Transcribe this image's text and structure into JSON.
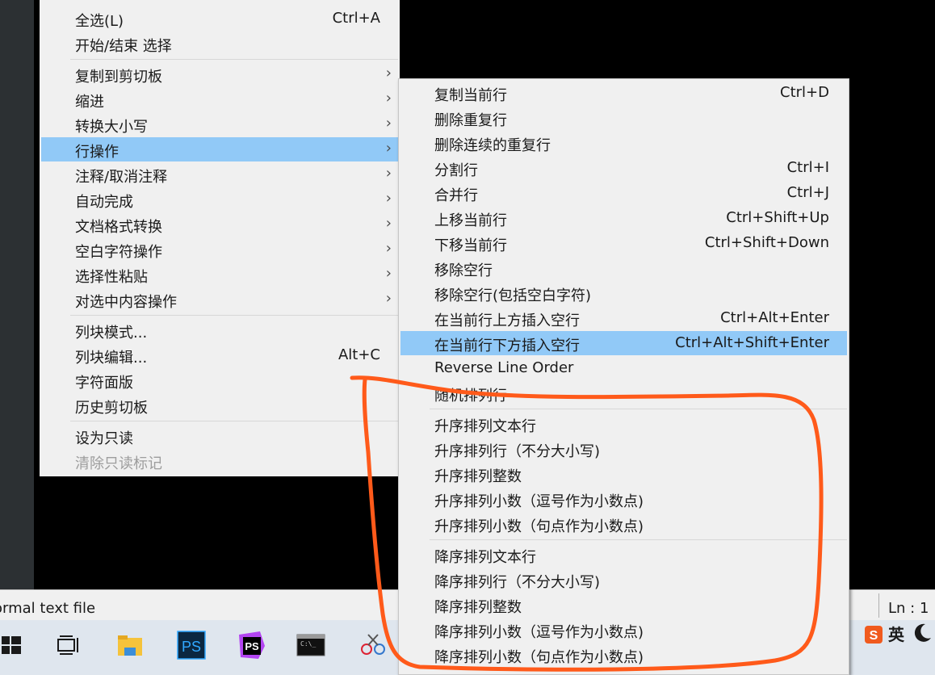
{
  "main_menu": {
    "items": [
      {
        "label": "全选(L)",
        "shortcut": "Ctrl+A"
      },
      {
        "label": "开始/结束 选择"
      },
      {
        "label": "复制到剪切板",
        "arrow": "›"
      },
      {
        "label": "缩进",
        "arrow": "›"
      },
      {
        "label": "转换大小写",
        "arrow": "›"
      },
      {
        "label": "行操作",
        "arrow": "›"
      },
      {
        "label": "注释/取消注释",
        "arrow": "›"
      },
      {
        "label": "自动完成",
        "arrow": "›"
      },
      {
        "label": "文档格式转换",
        "arrow": "›"
      },
      {
        "label": "空白字符操作",
        "arrow": "›"
      },
      {
        "label": "选择性粘贴",
        "arrow": "›"
      },
      {
        "label": "对选中内容操作",
        "arrow": "›"
      },
      {
        "label": "列块模式..."
      },
      {
        "label": "列块编辑...",
        "shortcut": "Alt+C"
      },
      {
        "label": "字符面版"
      },
      {
        "label": "历史剪切板"
      },
      {
        "label": "设为只读"
      },
      {
        "label": "清除只读标记"
      }
    ],
    "highlighted_item": "行操作",
    "disabled_item": "清除只读标记"
  },
  "submenu": {
    "items": [
      {
        "label": "复制当前行",
        "shortcut": "Ctrl+D"
      },
      {
        "label": "删除重复行"
      },
      {
        "label": "删除连续的重复行"
      },
      {
        "label": "分割行",
        "shortcut": "Ctrl+I"
      },
      {
        "label": "合并行",
        "shortcut": "Ctrl+J"
      },
      {
        "label": "上移当前行",
        "shortcut": "Ctrl+Shift+Up"
      },
      {
        "label": "下移当前行",
        "shortcut": "Ctrl+Shift+Down"
      },
      {
        "label": "移除空行"
      },
      {
        "label": "移除空行(包括空白字符)"
      },
      {
        "label": "在当前行上方插入空行",
        "shortcut": "Ctrl+Alt+Enter"
      },
      {
        "label": "在当前行下方插入空行",
        "shortcut": "Ctrl+Alt+Shift+Enter"
      },
      {
        "label": "Reverse Line Order"
      },
      {
        "label": "随机排列行"
      },
      {
        "label": "升序排列文本行"
      },
      {
        "label": "升序排列行（不分大小写)"
      },
      {
        "label": "升序排列整数"
      },
      {
        "label": "升序排列小数（逗号作为小数点)"
      },
      {
        "label": "升序排列小数（句点作为小数点)"
      },
      {
        "label": "降序排列文本行"
      },
      {
        "label": "降序排列行（不分大小写)"
      },
      {
        "label": "降序排列整数"
      },
      {
        "label": "降序排列小数（逗号作为小数点)"
      },
      {
        "label": "降序排列小数（句点作为小数点)"
      }
    ],
    "highlighted_item": "在当前行下方插入空行"
  },
  "status_bar": {
    "file_type": "ormal text file",
    "position": "Ln : 1"
  },
  "taskbar": {
    "icons": [
      "windows-start-icon",
      "task-view-icon",
      "file-explorer-icon",
      "photoshop-icon",
      "phpstorm-icon",
      "terminal-icon",
      "snipping-tool-icon"
    ],
    "ps_label": "PS",
    "phpstorm_label": "PS"
  },
  "tray": {
    "ime_label": "英",
    "sogou_label": "S"
  },
  "colors": {
    "menu_bg": "#f0f0f0",
    "highlight": "#91c9f7",
    "annotation": "#ff5a1a",
    "editor_bg": "#000000",
    "taskbar_bg": "#dfe6ee"
  }
}
